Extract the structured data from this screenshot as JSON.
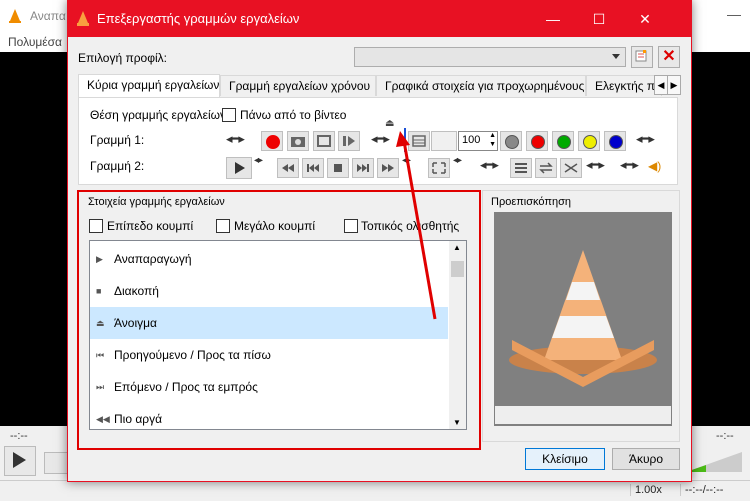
{
  "bg_window": {
    "title": "Αναπα",
    "menu": "Πολυμέσα",
    "minimize": "—",
    "time_left": "--:--",
    "time_right": "--:--",
    "speed": "1.00x",
    "status_time": "--:--/--:--"
  },
  "dialog": {
    "title": "Επεξεργαστής γραμμών εργαλείων",
    "controls": {
      "minimize": "—",
      "maximize": "☐",
      "close": "✕"
    },
    "profile_label": "Επιλογή προφίλ:",
    "profile_value": "",
    "tabs": [
      {
        "label": "Κύρια γραμμή εργαλείων",
        "active": true
      },
      {
        "label": "Γραμμή εργαλείων χρόνου",
        "active": false
      },
      {
        "label": "Γραφικά στοιχεία για προχωρημένους",
        "active": false
      },
      {
        "label": "Ελεγκτής πλη",
        "active": false
      }
    ],
    "position_label": "Θέση γραμμής εργαλείων:",
    "above_video_label": "Πάνω από το βίντεο",
    "above_video_checked": false,
    "line1_label": "Γραμμή 1:",
    "line2_label": "Γραμμή 2:",
    "line1_spinner": "100",
    "elements_group": {
      "title": "Στοιχεία γραμμής εργαλείων",
      "flat_button": "Επίπεδο κουμπί",
      "big_button": "Μεγάλο κουμπί",
      "native_slider": "Τοπικός ολισθητής",
      "items": [
        {
          "icon": "play-icon",
          "glyph": "▶",
          "label": "Αναπαραγωγή"
        },
        {
          "icon": "stop-icon",
          "glyph": "■",
          "label": "Διακοπή"
        },
        {
          "icon": "eject-icon",
          "glyph": "⏏",
          "label": "Άνοιγμα",
          "selected": true
        },
        {
          "icon": "previous-icon",
          "glyph": "⏮",
          "label": "Προηγούμενο / Προς τα πίσω"
        },
        {
          "icon": "next-icon",
          "glyph": "⏭",
          "label": "Επόμενο / Προς τα εμπρός"
        },
        {
          "icon": "slower-icon",
          "glyph": "◀◀",
          "label": "Πιο αργά"
        }
      ]
    },
    "preview_title": "Προεπισκόπηση",
    "close_button": "Κλείσιμο",
    "cancel_button": "Άκυρο"
  }
}
